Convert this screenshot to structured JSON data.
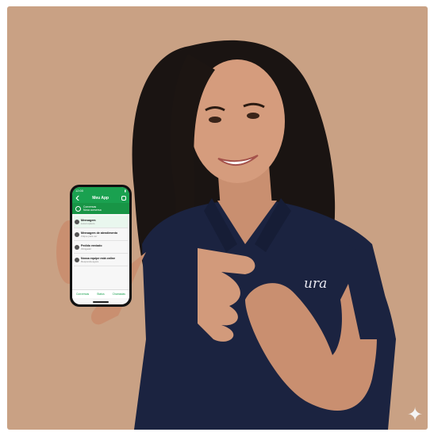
{
  "photo": {
    "subject": "woman",
    "background_color": "#c9a184",
    "shirt_color": "#1b2340",
    "shirt_logo": "ura"
  },
  "phone": {
    "status_time": "12:00",
    "app_title": "Meu App",
    "banner": {
      "line1": "Conversas",
      "line2": "Nova conversa"
    },
    "chats": [
      {
        "title": "Mensagem",
        "sub": "Lorem ipsum"
      },
      {
        "title": "Mensagem de atendimento",
        "sub": "Clique para ver"
      },
      {
        "title": "Pedido enviado",
        "sub": "Obrigado!"
      },
      {
        "title": "Nossa equipe está online",
        "sub": "Responda agora"
      }
    ],
    "bottom_tabs": [
      "Conversas",
      "Status",
      "Chamadas"
    ]
  },
  "overlay": {
    "sparkle_icon": "sparkle-icon"
  }
}
